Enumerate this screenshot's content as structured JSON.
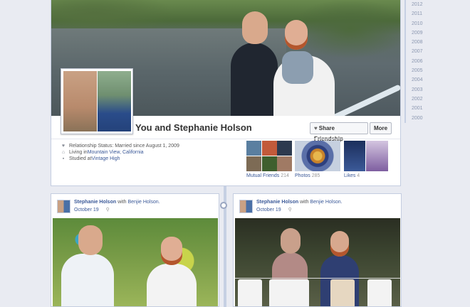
{
  "profile": {
    "name": "You and Stephanie Holson",
    "share_button": "Share Friendship",
    "more_button": "More",
    "info": [
      {
        "icon": "heart-icon",
        "prefix": "Relationship Status: Married since August 1, 2009",
        "link": ""
      },
      {
        "icon": "home-icon",
        "prefix": "Living in ",
        "link": "Mountain View, California"
      },
      {
        "icon": "education-icon",
        "prefix": "Studied at ",
        "link": "Vintage High"
      }
    ],
    "thumbs": {
      "mutual_friends": {
        "label": "Mutual Friends",
        "count": "214"
      },
      "photos": {
        "label": "Photos",
        "count": "285"
      },
      "likes": {
        "label": "Likes",
        "count": "4"
      }
    }
  },
  "posts": [
    {
      "author": "Stephanie Holson",
      "with_text": " with ",
      "with_link": "Benjie Holson.",
      "date": "October 19"
    },
    {
      "author": "Stephanie Holson",
      "with_text": " with ",
      "with_link": "Benjie Holson.",
      "date": "October 19"
    }
  ],
  "years": [
    "2012",
    "2011",
    "2010",
    "2009",
    "2008",
    "2007",
    "2006",
    "2005",
    "2004",
    "2003",
    "2002",
    "2001",
    "2000"
  ],
  "colors": {
    "link": "#3b5998",
    "background": "#e9ebf2",
    "border": "#c4cde0"
  }
}
